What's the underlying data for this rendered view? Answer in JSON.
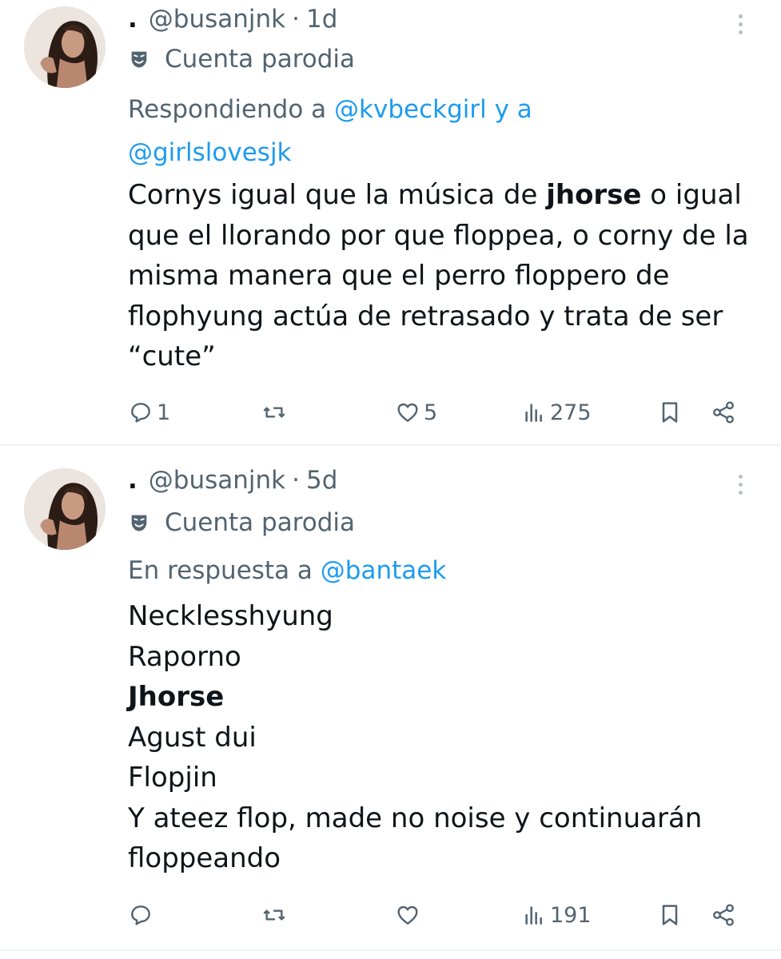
{
  "tweets": [
    {
      "name_prefix": ".",
      "handle": "@busanjnk",
      "separator": "·",
      "time": "1d",
      "parody_label": "Cuenta parodia",
      "reply_prefix": "Respondiendo a ",
      "reply_user1": "@kvbeckgirl",
      "reply_joiner": " y a ",
      "reply_user2": "@girlslovesjk",
      "text_part1": "Cornys igual que la música de ",
      "text_bold": "jhorse",
      "text_part2": " o igual que el llorando por que floppea, o corny de la misma manera que el perro floppero de flophyung actúa de retrasado y trata de ser “cute”",
      "reply_count": "1",
      "retweet_count": "",
      "like_count": "5",
      "view_count": "275"
    },
    {
      "name_prefix": ".",
      "handle": "@busanjnk",
      "separator": "·",
      "time": "5d",
      "parody_label": "Cuenta parodia",
      "reply_prefix": "En respuesta a ",
      "reply_user1": "@bantaek",
      "lines": [
        "Necklesshyung",
        "Raporno"
      ],
      "bold_line": "Jhorse",
      "lines_after": [
        "Agust dui",
        "Flopjin",
        "Y ateez flop, made no noise y continuarán floppeando"
      ],
      "reply_count": "",
      "retweet_count": "",
      "like_count": "",
      "view_count": "191"
    }
  ],
  "colors": {
    "secondary_text": "#536471",
    "link": "#1d9bf0",
    "primary_text": "#0f1419",
    "divider": "#eff3f4"
  }
}
